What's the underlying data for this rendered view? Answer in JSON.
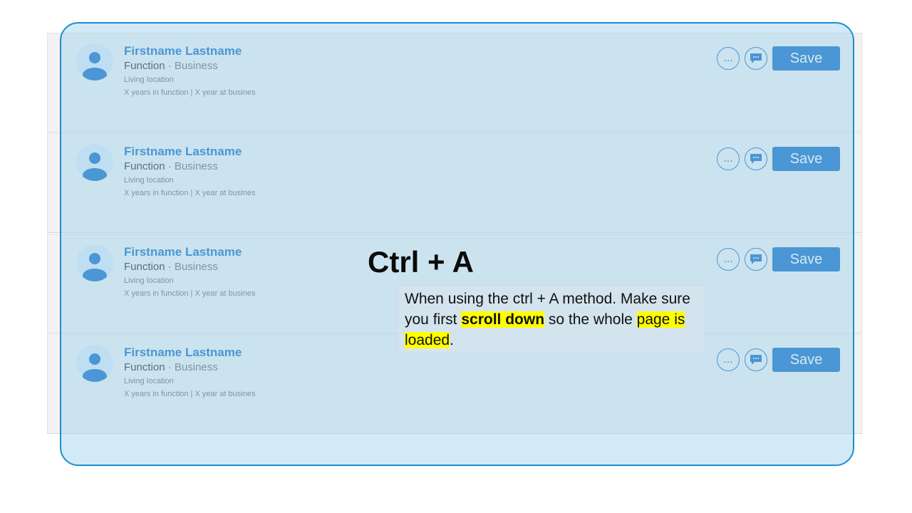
{
  "profiles": [
    {
      "name": "Firstname Lastname",
      "function": "Function",
      "business": "Business",
      "location": "Living location",
      "years": "X years  in function | X year at busines",
      "save_label": "Save",
      "more_label": "..."
    },
    {
      "name": "Firstname Lastname",
      "function": "Function",
      "business": "Business",
      "location": "Living location",
      "years": "X years  in function | X year at busines",
      "save_label": "Save",
      "more_label": "..."
    },
    {
      "name": "Firstname Lastname",
      "function": "Function",
      "business": "Business",
      "location": "Living location",
      "years": "X years  in function | X year at busines",
      "save_label": "Save",
      "more_label": "..."
    },
    {
      "name": "Firstname Lastname",
      "function": "Function",
      "business": "Business",
      "location": "Living location",
      "years": "X years  in function | X year at busines",
      "save_label": "Save",
      "more_label": "..."
    }
  ],
  "separator": "·",
  "icons": {
    "avatar": "person-avatar-icon",
    "more": "more-options-icon",
    "message": "message-icon"
  },
  "colors": {
    "accent": "#0a66c2",
    "overlay": "#9cd0ec",
    "highlight": "#ffff00"
  },
  "callout": {
    "title": "Ctrl + A",
    "text_part1": "When using the ctrl + A method. Make sure you first ",
    "text_bold": "scroll down",
    "text_part2": " so the whole ",
    "text_highlight": "page is loaded",
    "text_end": "."
  }
}
